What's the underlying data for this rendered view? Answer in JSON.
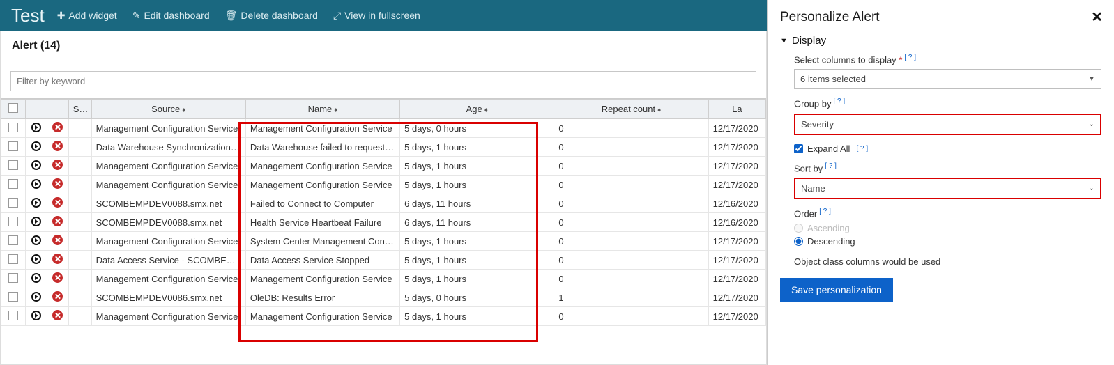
{
  "header": {
    "title": "Test",
    "add_widget": "Add widget",
    "edit_dashboard": "Edit dashboard",
    "delete_dashboard": "Delete dashboard",
    "fullscreen": "View in fullscreen"
  },
  "alert_widget": {
    "title": "Alert (14)",
    "filter_placeholder": "Filter by keyword",
    "columns": {
      "severity": "Sever",
      "source": "Source",
      "name": "Name",
      "age": "Age",
      "repeat": "Repeat count",
      "last": "La"
    },
    "rows": [
      {
        "source": "Management Configuration Service",
        "name": "Management Configuration Service ",
        "age": "5 days, 0 hours",
        "repeat": "0",
        "last": "12/17/2020"
      },
      {
        "source": "Data Warehouse Synchronization Se",
        "name": "Data Warehouse failed to request a l",
        "age": "5 days, 1 hours",
        "repeat": "0",
        "last": "12/17/2020"
      },
      {
        "source": "Management Configuration Service",
        "name": "Management Configuration Service ",
        "age": "5 days, 1 hours",
        "repeat": "0",
        "last": "12/17/2020"
      },
      {
        "source": "Management Configuration Service",
        "name": "Management Configuration Service ",
        "age": "5 days, 1 hours",
        "repeat": "0",
        "last": "12/17/2020"
      },
      {
        "source": "SCOMBEMPDEV0088.smx.net",
        "name": "Failed to Connect to Computer",
        "age": "6 days, 11 hours",
        "repeat": "0",
        "last": "12/16/2020"
      },
      {
        "source": "SCOMBEMPDEV0088.smx.net",
        "name": "Health Service Heartbeat Failure",
        "age": "6 days, 11 hours",
        "repeat": "0",
        "last": "12/16/2020"
      },
      {
        "source": "Management Configuration Service",
        "name": "System Center Management Configu",
        "age": "5 days, 1 hours",
        "repeat": "0",
        "last": "12/17/2020"
      },
      {
        "source": "Data Access Service - SCOMBEMPDE",
        "name": "Data Access Service Stopped",
        "age": "5 days, 1 hours",
        "repeat": "0",
        "last": "12/17/2020"
      },
      {
        "source": "Management Configuration Service",
        "name": "Management Configuration Service ",
        "age": "5 days, 1 hours",
        "repeat": "0",
        "last": "12/17/2020"
      },
      {
        "source": "SCOMBEMPDEV0086.smx.net",
        "name": "OleDB: Results Error",
        "age": "5 days, 0 hours",
        "repeat": "1",
        "last": "12/17/2020"
      },
      {
        "source": "Management Configuration Service",
        "name": "Management Configuration Service ",
        "age": "5 days, 1 hours",
        "repeat": "0",
        "last": "12/17/2020"
      }
    ]
  },
  "side": {
    "title": "Personalize Alert",
    "display_section": "Display",
    "select_cols": "Select columns to display",
    "cols_selected": "6 items selected",
    "group_by": "Group by",
    "group_by_val": "Severity",
    "expand_all": "Expand All",
    "sort_by": "Sort by",
    "sort_by_val": "Name",
    "order": "Order",
    "ascending": "Ascending",
    "descending": "Descending",
    "note": "Object class columns would be used",
    "save": "Save personalization",
    "help": "[ ? ]"
  }
}
